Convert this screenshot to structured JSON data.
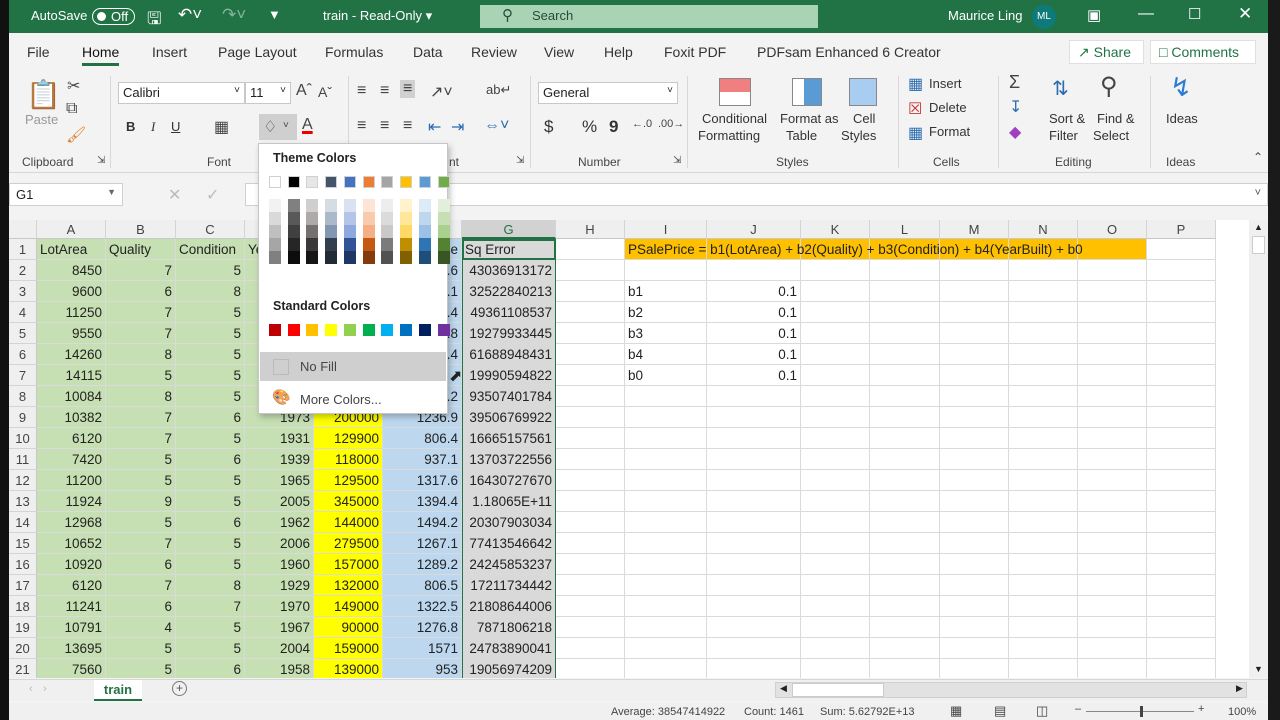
{
  "titlebar": {
    "autosave_label": "AutoSave",
    "autosave_state": "Off",
    "file_title": "train  -  Read-Only",
    "search_placeholder": "Search",
    "user_name": "Maurice Ling",
    "user_initials": "ML"
  },
  "tabs": [
    "File",
    "Home",
    "Insert",
    "Page Layout",
    "Formulas",
    "Data",
    "Review",
    "View",
    "Help",
    "Foxit PDF",
    "PDFsam Enhanced 6 Creator"
  ],
  "active_tab": "Home",
  "share_label": "Share",
  "comments_label": "Comments",
  "ribbon": {
    "clipboard": {
      "paste": "Paste",
      "group": "Clipboard"
    },
    "font": {
      "name": "Calibri",
      "size": "11",
      "bold": "B",
      "italic": "I",
      "underline": "U",
      "group": "Font"
    },
    "alignment": {
      "group_fragment": "nt"
    },
    "number": {
      "format": "General",
      "currency": "$",
      "percent": "%",
      "comma": "9",
      "group": "Number"
    },
    "styles": {
      "conditional": "Conditional",
      "conditional2": "Formatting",
      "format_table": "Format as",
      "format_table2": "Table",
      "cell_styles": "Cell",
      "cell_styles2": "Styles",
      "group": "Styles"
    },
    "cells": {
      "insert": "Insert",
      "delete": "Delete",
      "format": "Format",
      "group": "Cells"
    },
    "editing": {
      "sort": "Sort &",
      "sort2": "Filter",
      "find": "Find &",
      "find2": "Select",
      "group": "Editing"
    },
    "ideas": {
      "label": "Ideas",
      "group": "Ideas"
    }
  },
  "formula_bar": {
    "name_box": "G1",
    "formula": ""
  },
  "fill_dropdown": {
    "theme_title": "Theme Colors",
    "standard_title": "Standard Colors",
    "no_fill": "No Fill",
    "more_colors": "More Colors...",
    "theme_colors": [
      [
        "#FFFFFF",
        "#000000",
        "#E7E6E6",
        "#44546A",
        "#4472C4",
        "#ED7D31",
        "#A5A5A5",
        "#FFC000",
        "#5B9BD5",
        "#70AD47"
      ],
      [
        "#F2F2F2",
        "#808080",
        "#D0CECE",
        "#D6DCE4",
        "#D9E1F2",
        "#FCE4D6",
        "#EDEDED",
        "#FFF2CC",
        "#DDEBF7",
        "#E2EFDA"
      ],
      [
        "#D9D9D9",
        "#595959",
        "#AEAAAA",
        "#ACB9CA",
        "#B4C6E7",
        "#F8CBAD",
        "#DBDBDB",
        "#FFE699",
        "#BDD7EE",
        "#C6E0B4"
      ],
      [
        "#BFBFBF",
        "#404040",
        "#757171",
        "#8497B0",
        "#8EA9DB",
        "#F4B084",
        "#C9C9C9",
        "#FFD966",
        "#9BC2E6",
        "#A9D08E"
      ],
      [
        "#A6A6A6",
        "#262626",
        "#3A3838",
        "#333F4F",
        "#305496",
        "#C65911",
        "#7B7B7B",
        "#BF8F00",
        "#2F75B5",
        "#548235"
      ],
      [
        "#808080",
        "#0D0D0D",
        "#171616",
        "#222B35",
        "#203764",
        "#833C0C",
        "#525252",
        "#806000",
        "#1F4E78",
        "#375623"
      ]
    ],
    "standard_colors": [
      "#C00000",
      "#FF0000",
      "#FFC000",
      "#FFFF00",
      "#92D050",
      "#00B050",
      "#00B0F0",
      "#0070C0",
      "#002060",
      "#7030A0"
    ]
  },
  "grid": {
    "columns": [
      "A",
      "B",
      "C",
      "D",
      "E",
      "F",
      "G",
      "H",
      "I",
      "J",
      "K",
      "L",
      "M",
      "N",
      "O",
      "P"
    ],
    "column_fills": {
      "A": "#C6E0B4",
      "B": "#C6E0B4",
      "C": "#C6E0B4",
      "D": "#C6E0B4",
      "E": "#FFFF00",
      "F": "#BDD7EE",
      "G": "#D9D9D9"
    },
    "formula_fill": "#FFC000",
    "formula_text": "PSalePrice = b1(LotArea) + b2(Quality) + b3(Condition) + b4(YearBuilt) + b0",
    "rows": [
      [
        "LotArea",
        "Quality",
        "Condition",
        "Ye",
        "",
        "ce",
        "Sq Error",
        "",
        "",
        "",
        "",
        "",
        "",
        "",
        "",
        ""
      ],
      [
        "8450",
        "7",
        "5",
        "",
        "",
        ".6",
        "43036913172",
        "",
        "",
        "",
        "",
        "",
        "",
        "",
        "",
        ""
      ],
      [
        "9600",
        "6",
        "8",
        "",
        "",
        ".1",
        "32522840213",
        "",
        "b1",
        "0.1",
        "",
        "",
        "",
        "",
        "",
        ""
      ],
      [
        "11250",
        "7",
        "5",
        "",
        "",
        ".4",
        "49361108537",
        "",
        "b2",
        "0.1",
        "",
        "",
        "",
        "",
        "",
        ""
      ],
      [
        "9550",
        "7",
        "5",
        "",
        "",
        ".8",
        "19279933445",
        "",
        "b3",
        "0.1",
        "",
        "",
        "",
        "",
        "",
        ""
      ],
      [
        "14260",
        "8",
        "5",
        "",
        "",
        ".4",
        "61688948431",
        "",
        "b4",
        "0.1",
        "",
        "",
        "",
        "",
        "",
        ""
      ],
      [
        "14115",
        "5",
        "5",
        "",
        "",
        "",
        "19990594822",
        "",
        "b0",
        "0.1",
        "",
        "",
        "",
        "",
        "",
        ""
      ],
      [
        "10084",
        "8",
        "5",
        "",
        "",
        ".2",
        "93507401784",
        "",
        "",
        "",
        "",
        "",
        "",
        "",
        "",
        ""
      ],
      [
        "10382",
        "7",
        "6",
        "1973",
        "200000",
        "1236.9",
        "39506769922",
        "",
        "",
        "",
        "",
        "",
        "",
        "",
        "",
        ""
      ],
      [
        "6120",
        "7",
        "5",
        "1931",
        "129900",
        "806.4",
        "16665157561",
        "",
        "",
        "",
        "",
        "",
        "",
        "",
        "",
        ""
      ],
      [
        "7420",
        "5",
        "6",
        "1939",
        "118000",
        "937.1",
        "13703722556",
        "",
        "",
        "",
        "",
        "",
        "",
        "",
        "",
        ""
      ],
      [
        "11200",
        "5",
        "5",
        "1965",
        "129500",
        "1317.6",
        "16430727670",
        "",
        "",
        "",
        "",
        "",
        "",
        "",
        "",
        ""
      ],
      [
        "11924",
        "9",
        "5",
        "2005",
        "345000",
        "1394.4",
        "1.18065E+11",
        "",
        "",
        "",
        "",
        "",
        "",
        "",
        "",
        ""
      ],
      [
        "12968",
        "5",
        "6",
        "1962",
        "144000",
        "1494.2",
        "20307903034",
        "",
        "",
        "",
        "",
        "",
        "",
        "",
        "",
        ""
      ],
      [
        "10652",
        "7",
        "5",
        "2006",
        "279500",
        "1267.1",
        "77413546642",
        "",
        "",
        "",
        "",
        "",
        "",
        "",
        "",
        ""
      ],
      [
        "10920",
        "6",
        "5",
        "1960",
        "157000",
        "1289.2",
        "24245853237",
        "",
        "",
        "",
        "",
        "",
        "",
        "",
        "",
        ""
      ],
      [
        "6120",
        "7",
        "8",
        "1929",
        "132000",
        "806.5",
        "17211734442",
        "",
        "",
        "",
        "",
        "",
        "",
        "",
        "",
        ""
      ],
      [
        "11241",
        "6",
        "7",
        "1970",
        "149000",
        "1322.5",
        "21808644006",
        "",
        "",
        "",
        "",
        "",
        "",
        "",
        "",
        ""
      ],
      [
        "10791",
        "4",
        "5",
        "1967",
        "90000",
        "1276.8",
        "7871806218",
        "",
        "",
        "",
        "",
        "",
        "",
        "",
        "",
        ""
      ],
      [
        "13695",
        "5",
        "5",
        "2004",
        "159000",
        "1571",
        "24783890041",
        "",
        "",
        "",
        "",
        "",
        "",
        "",
        "",
        ""
      ],
      [
        "7560",
        "5",
        "6",
        "1958",
        "139000",
        "953",
        "19056974209",
        "",
        "",
        "",
        "",
        "",
        "",
        "",
        "",
        ""
      ]
    ]
  },
  "sheet_tabs": [
    "train"
  ],
  "status": {
    "average": "Average: 38547414922",
    "count": "Count: 1461",
    "sum": "Sum: 5.62792E+13",
    "zoom": "100%",
    "zoom_level_percent": 100
  }
}
